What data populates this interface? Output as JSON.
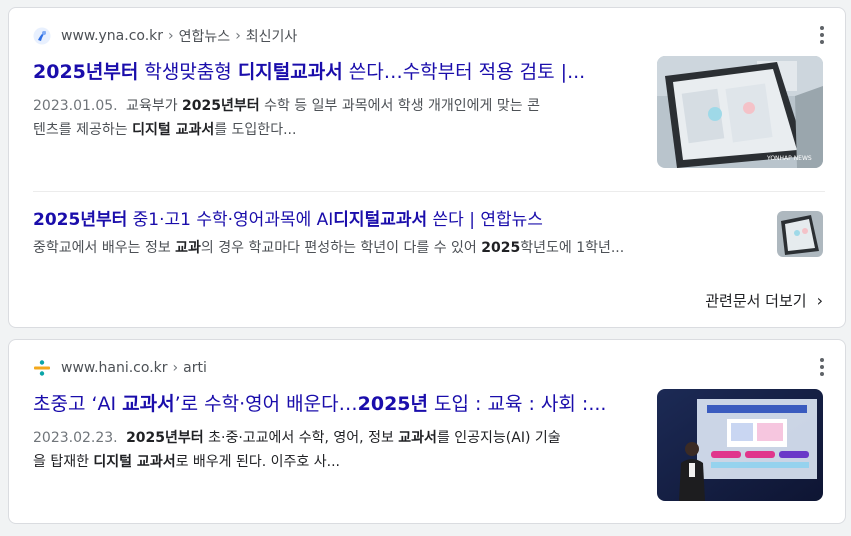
{
  "result1": {
    "source": {
      "domain": "www.yna.co.kr",
      "path1": "연합뉴스",
      "path2": "최신기사",
      "sep": "›"
    },
    "title": {
      "b1": "2025년부터",
      "t1": " 학생맞춤형 ",
      "b2": "디지털교과서",
      "t2": " 쓴다…수학부터 적용 검토 |..."
    },
    "snippet": {
      "date": "2023.01.05.",
      "p1": " 교육부가 ",
      "b1": "2025년부터",
      "p2": " 수학 등 일부 과목에서 학생 개개인에게 맞는 콘",
      "p3": "텐츠를 제공하는 ",
      "b2": "디지털 교과서",
      "p4": "를 도입한다..."
    },
    "thumb_icon": "tablet-screen-photo"
  },
  "sub_result": {
    "title": {
      "b1": "2025년부터",
      "t1": " 중1·고1 수학·영어과목에 AI",
      "b2": "디지털교과서",
      "t2": " 쓴다 | 연합뉴스"
    },
    "snippet": {
      "p1": "중학교에서 배우는 정보 ",
      "b1": "교과",
      "p2": "의 경우 학교마다 편성하는 학년이 다를 수 있어 ",
      "b2": "2025",
      "p3": "학년도에 1학년..."
    }
  },
  "more_link": {
    "label": "관련문서 더보기",
    "chevron": "›"
  },
  "result2": {
    "source": {
      "domain": "www.hani.co.kr",
      "path1": "arti",
      "sep": "›"
    },
    "title": {
      "t0": "초중고 ‘AI ",
      "b1": "교과서",
      "t1": "’로 수학·영어 배운다…",
      "b2": "2025년",
      "t2": " 도입 : 교육 : 사회 :..."
    },
    "snippet": {
      "date": "2023.02.23.",
      "b1": "2025년부터",
      "p1": " 초·중·고교에서 수학, 영어, 정보 ",
      "b2": "교과서",
      "p2": "를 인공지능(AI) 기술",
      "p3": "을 탑재한 ",
      "b3": "디지털 교과서",
      "p4": "로 배우게 된다. 이주호 사..."
    },
    "thumb_icon": "presenter-stage-photo"
  },
  "colors": {
    "link": "#1a0dab",
    "text": "#4d5156",
    "bold": "#202124",
    "background": "#f1f3f4"
  }
}
